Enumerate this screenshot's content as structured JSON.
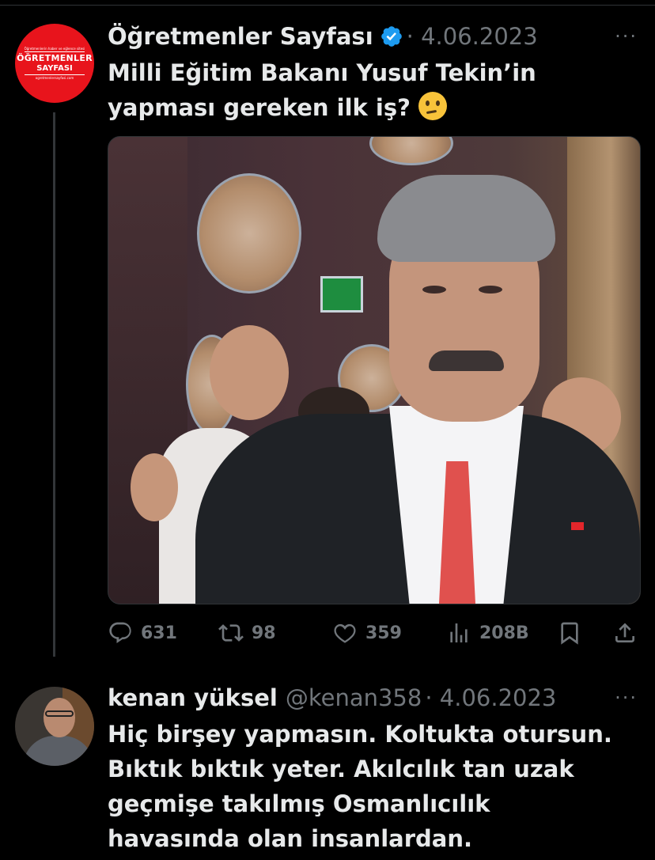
{
  "tweet1": {
    "display_name": "Öğretmenler Sayfası",
    "date": "· 4.06.2023",
    "more": "···",
    "text": "Milli Eğitim Bakanı Yusuf Tekin’in yapması gereken ilk iş?",
    "avatar": {
      "tagline": "Öğretmenlerin haber ve eğlence sitesi",
      "line1": "ÖĞRETMENLER",
      "line2": "SAYFASI",
      "url": "ogretmenlersayfasi.com"
    },
    "stats": {
      "replies": "631",
      "retweets": "98",
      "likes": "359",
      "views": "208B"
    },
    "emoji": "thinking-face-icon"
  },
  "tweet2": {
    "display_name": "kenan yüksel",
    "handle": "@kenan358",
    "date": "· 4.06.2023",
    "more": "···",
    "lines": [
      "Hiç birşey yapmasın. Koltukta otursun.",
      "Bıktık bıktık yeter. Akılcılık tan uzak",
      "geçmişe takılmış Osmanlıcılık",
      "havasında olan insanlardan."
    ]
  },
  "colors": {
    "background": "#000000",
    "text": "#e7e9ea",
    "muted": "#71767b",
    "verified": "#1d9bf0",
    "avatar_red": "#e8141c"
  }
}
